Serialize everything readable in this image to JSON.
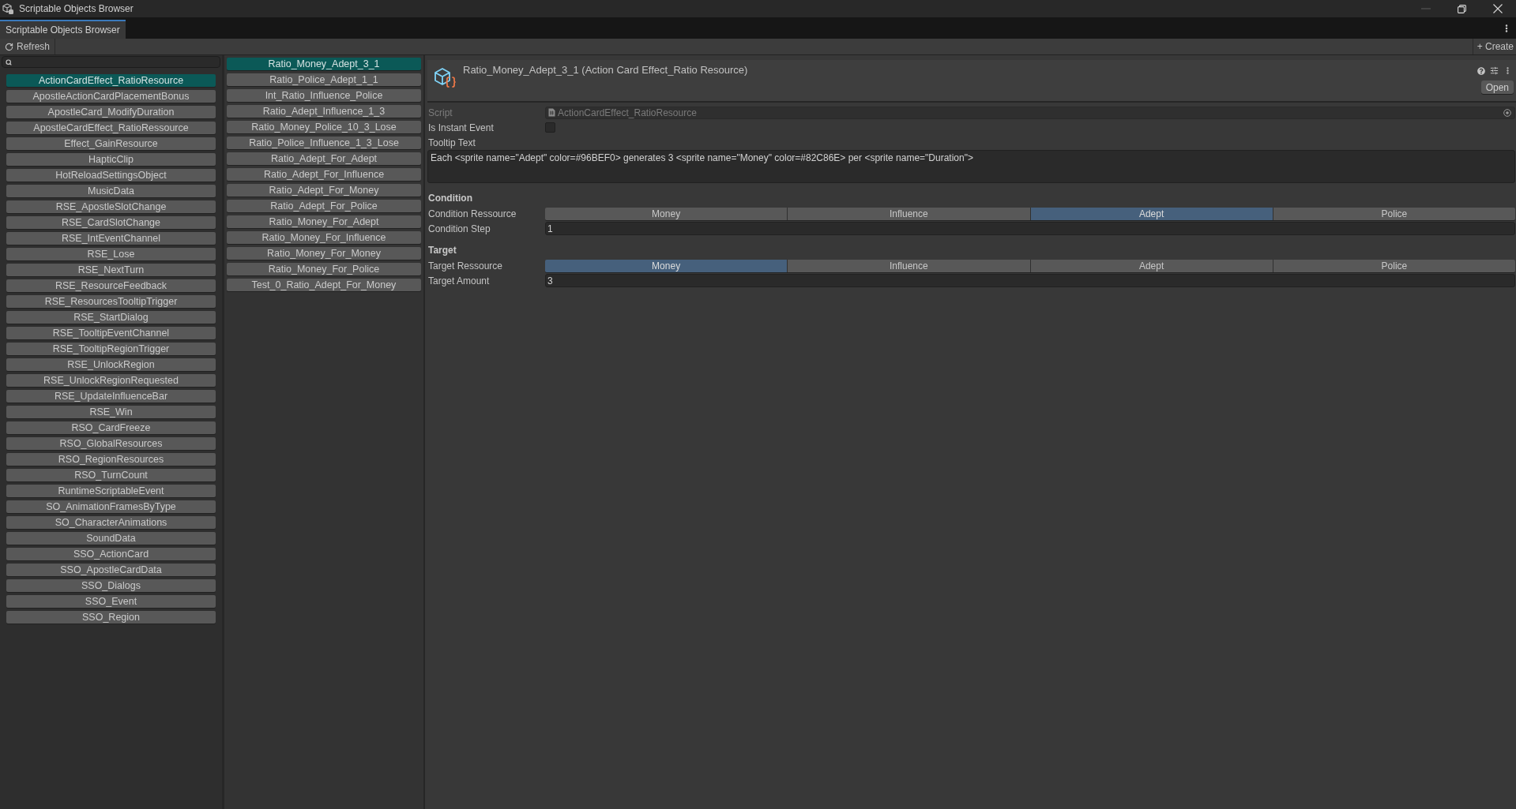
{
  "window": {
    "title": "Scriptable Objects Browser"
  },
  "tabs": [
    {
      "label": "Scriptable Objects Browser",
      "selected": true
    }
  ],
  "toolbar": {
    "refresh_button": "Refresh",
    "create_button": "+ Create"
  },
  "type_list": {
    "items": [
      {
        "label": "ActionCardEffect_RatioResource",
        "selected": true
      },
      {
        "label": "ApostleActionCardPlacementBonus",
        "selected": false
      },
      {
        "label": "ApostleCard_ModifyDuration",
        "selected": false
      },
      {
        "label": "ApostleCardEffect_RatioRessource",
        "selected": false
      },
      {
        "label": "Effect_GainResource",
        "selected": false
      },
      {
        "label": "HapticClip",
        "selected": false
      },
      {
        "label": "HotReloadSettingsObject",
        "selected": false
      },
      {
        "label": "MusicData",
        "selected": false
      },
      {
        "label": "RSE_ApostleSlotChange",
        "selected": false
      },
      {
        "label": "RSE_CardSlotChange",
        "selected": false
      },
      {
        "label": "RSE_IntEventChannel",
        "selected": false
      },
      {
        "label": "RSE_Lose",
        "selected": false
      },
      {
        "label": "RSE_NextTurn",
        "selected": false
      },
      {
        "label": "RSE_ResourceFeedback",
        "selected": false
      },
      {
        "label": "RSE_ResourcesTooltipTrigger",
        "selected": false
      },
      {
        "label": "RSE_StartDialog",
        "selected": false
      },
      {
        "label": "RSE_TooltipEventChannel",
        "selected": false
      },
      {
        "label": "RSE_TooltipRegionTrigger",
        "selected": false
      },
      {
        "label": "RSE_UnlockRegion",
        "selected": false
      },
      {
        "label": "RSE_UnlockRegionRequested",
        "selected": false
      },
      {
        "label": "RSE_UpdateInfluenceBar",
        "selected": false
      },
      {
        "label": "RSE_Win",
        "selected": false
      },
      {
        "label": "RSO_CardFreeze",
        "selected": false
      },
      {
        "label": "RSO_GlobalResources",
        "selected": false
      },
      {
        "label": "RSO_RegionResources",
        "selected": false
      },
      {
        "label": "RSO_TurnCount",
        "selected": false
      },
      {
        "label": "RuntimeScriptableEvent",
        "selected": false
      },
      {
        "label": "SO_AnimationFramesByType",
        "selected": false
      },
      {
        "label": "SO_CharacterAnimations",
        "selected": false
      },
      {
        "label": "SoundData",
        "selected": false
      },
      {
        "label": "SSO_ActionCard",
        "selected": false
      },
      {
        "label": "SSO_ApostleCardData",
        "selected": false
      },
      {
        "label": "SSO_Dialogs",
        "selected": false
      },
      {
        "label": "SSO_Event",
        "selected": false
      },
      {
        "label": "SSO_Region",
        "selected": false
      }
    ]
  },
  "asset_list": {
    "items": [
      {
        "label": "Ratio_Money_Adept_3_1",
        "selected": true
      },
      {
        "label": "Ratio_Police_Adept_1_1",
        "selected": false
      },
      {
        "label": "Int_Ratio_Influence_Police",
        "selected": false
      },
      {
        "label": "Ratio_Adept_Influence_1_3",
        "selected": false
      },
      {
        "label": "Ratio_Money_Police_10_3_Lose",
        "selected": false
      },
      {
        "label": "Ratio_Police_Influence_1_3_Lose",
        "selected": false
      },
      {
        "label": "Ratio_Adept_For_Adept",
        "selected": false
      },
      {
        "label": "Ratio_Adept_For_Influence",
        "selected": false
      },
      {
        "label": "Ratio_Adept_For_Money",
        "selected": false
      },
      {
        "label": "Ratio_Adept_For_Police",
        "selected": false
      },
      {
        "label": "Ratio_Money_For_Adept",
        "selected": false
      },
      {
        "label": "Ratio_Money_For_Influence",
        "selected": false
      },
      {
        "label": "Ratio_Money_For_Money",
        "selected": false
      },
      {
        "label": "Ratio_Money_For_Police",
        "selected": false
      },
      {
        "label": "Test_0_Ratio_Adept_For_Money",
        "selected": false
      }
    ]
  },
  "inspector": {
    "title": "Ratio_Money_Adept_3_1 (Action Card Effect_Ratio Resource)",
    "open_button": "Open",
    "fields": [
      {
        "kind": "object",
        "label": "Script",
        "value": "ActionCardEffect_RatioResource",
        "disabled": true
      },
      {
        "kind": "toggle",
        "label": "Is Instant Event",
        "checked": false
      },
      {
        "kind": "textarea",
        "label": "Tooltip Text",
        "value": "Each <sprite name=\"Adept\" color=#96BEF0> generates 3 <sprite name=\"Money\" color=#82C86E> per <sprite name=\"Duration\">"
      },
      {
        "kind": "header",
        "label": "Condition"
      },
      {
        "kind": "enum",
        "label": "Condition Ressource",
        "options": [
          {
            "label": "Money",
            "selected": false
          },
          {
            "label": "Influence",
            "selected": false
          },
          {
            "label": "Adept",
            "selected": true
          },
          {
            "label": "Police",
            "selected": false
          }
        ]
      },
      {
        "kind": "number",
        "label": "Condition Step",
        "value": "1"
      },
      {
        "kind": "header",
        "label": "Target"
      },
      {
        "kind": "enum",
        "label": "Target Ressource",
        "options": [
          {
            "label": "Money",
            "selected": true
          },
          {
            "label": "Influence",
            "selected": false
          },
          {
            "label": "Adept",
            "selected": false
          },
          {
            "label": "Police",
            "selected": false
          }
        ]
      },
      {
        "kind": "number",
        "label": "Target Amount",
        "value": "3"
      }
    ]
  }
}
